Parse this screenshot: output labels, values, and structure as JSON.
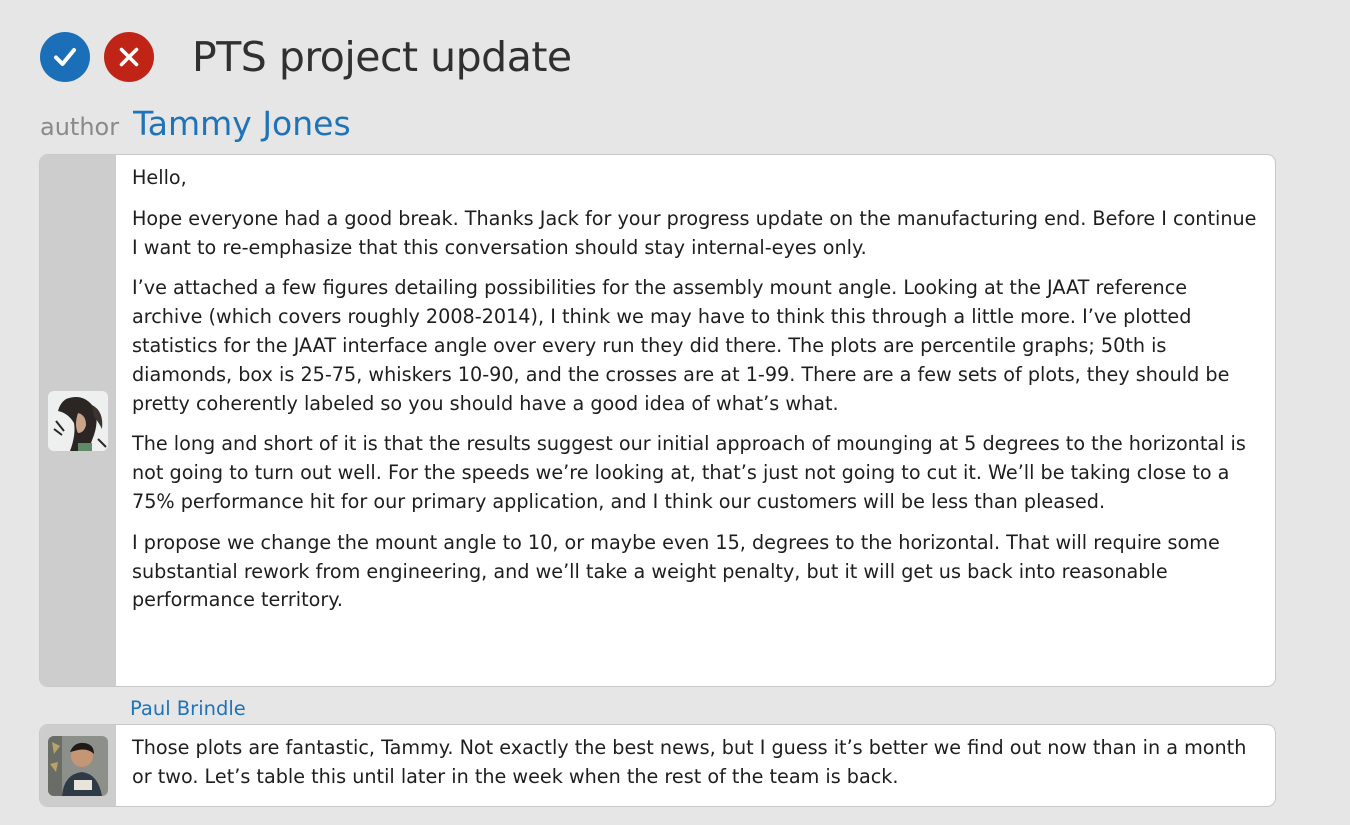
{
  "header": {
    "title": "PTS project update"
  },
  "author": {
    "label": "author",
    "name": "Tammy Jones"
  },
  "post": {
    "paragraphs": [
      "Hello,",
      "Hope everyone had a good break. Thanks Jack for your progress update on the manufacturing end. Before I continue I want to re-emphasize that this conversation should stay internal-eyes only.",
      "I’ve attached a few figures detailing possibilities for the assembly mount angle. Looking at the JAAT reference archive (which covers roughly 2008-2014), I think we may have to think this through a little more. I’ve plotted statistics for the JAAT interface angle over every run they did there. The plots are percentile graphs; 50th is diamonds, box is 25-75, whiskers 10-90, and the crosses are at 1-99. There are a few sets of plots, they should be pretty coherently labeled so you should have a good idea of what’s what.",
      "The long and short of it is that the results suggest our initial approach of mounging at 5 degrees to the horizontal is not going to turn out well. For the speeds we’re looking at, that’s just not going to cut it. We’ll be taking close to a 75% performance hit for our primary application, and I think our customers will be less than pleased.",
      "I propose we change the mount angle to 10, or maybe even 15, degrees to the horizontal. That will require some substantial rework from engineering, and we’ll take a weight penalty, but it will get us back into reasonable performance territory."
    ]
  },
  "reply": {
    "author": "Paul Brindle",
    "text": "Those plots are fantastic, Tammy. Not exactly the best news, but I guess it’s better we find out now than in a month or two. Let’s table this until later in the week when the rest of the team is back."
  },
  "colors": {
    "approve": "#1a6fb8",
    "reject": "#bf2417",
    "link": "#1f73b8"
  }
}
